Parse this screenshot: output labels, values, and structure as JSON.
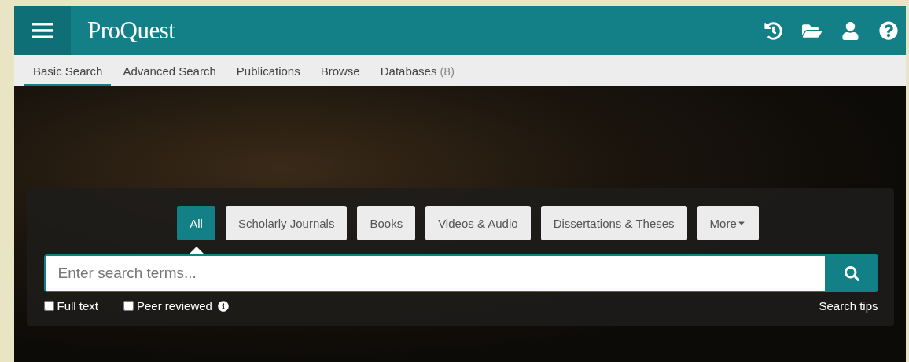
{
  "header": {
    "logo": "ProQuest"
  },
  "nav_tabs": [
    {
      "label": "Basic Search",
      "selected": true
    },
    {
      "label": "Advanced Search",
      "selected": false
    },
    {
      "label": "Publications",
      "selected": false
    },
    {
      "label": "Browse",
      "selected": false
    },
    {
      "label": "Databases",
      "count": "(8)",
      "selected": false
    }
  ],
  "source_types": [
    {
      "label": "All",
      "selected": true,
      "kind": "plain"
    },
    {
      "label": "Scholarly Journals",
      "selected": false,
      "kind": "plain"
    },
    {
      "label": "Books",
      "selected": false,
      "kind": "plain"
    },
    {
      "label": "Videos & Audio",
      "selected": false,
      "kind": "plain"
    },
    {
      "label": "Dissertations & Theses",
      "selected": false,
      "kind": "plain"
    },
    {
      "label": "More",
      "selected": false,
      "kind": "dropdown"
    }
  ],
  "search": {
    "placeholder": "Enter search terms..."
  },
  "filters": [
    {
      "label": "Full text",
      "checked": false,
      "info": false
    },
    {
      "label": "Peer reviewed",
      "checked": false,
      "info": true
    }
  ],
  "search_tips": "Search tips"
}
